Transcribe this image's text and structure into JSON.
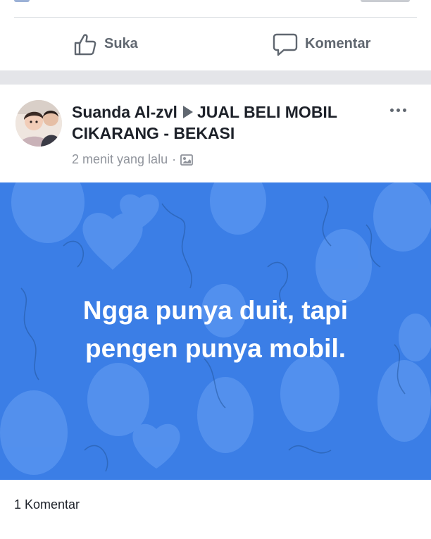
{
  "actions": {
    "like_label": "Suka",
    "comment_label": "Komentar"
  },
  "post": {
    "author": "Suanda Al-zvl",
    "group": "JUAL BELI MOBIL CIKARANG - BEKASI",
    "time": "2 menit yang lalu",
    "dot": "·",
    "text_line1": "Ngga punya duit, tapi",
    "text_line2": "pengen punya mobil.",
    "background_color": "#3b7ee6",
    "comments_count": "1 Komentar"
  },
  "icons": {
    "like": "thumbs-up-icon",
    "comment": "speech-bubble-icon",
    "audience": "group-photo-icon",
    "more": "more-dots-icon",
    "arrow": "triangle-right-icon"
  },
  "colors": {
    "post_bg": "#3b7ee6",
    "text_primary": "#1d2129",
    "text_secondary": "#90949c",
    "divider": "#e4e5e9"
  }
}
